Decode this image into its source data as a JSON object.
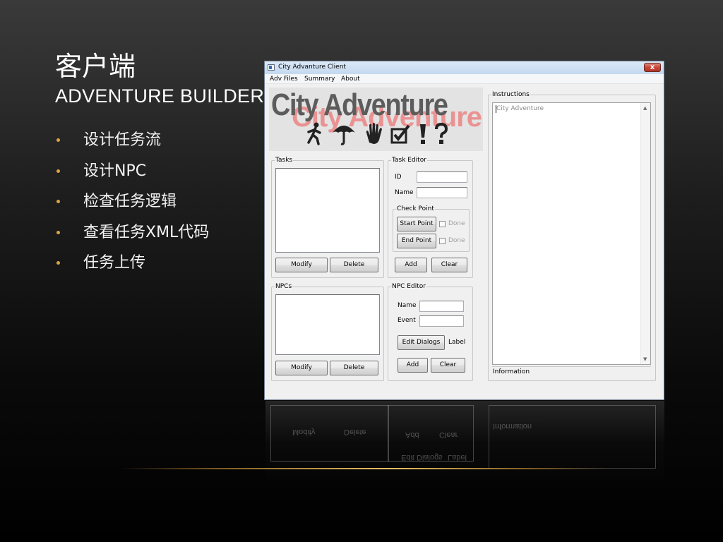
{
  "slide": {
    "title": "客户端",
    "subtitle": "ADVENTURE BUILDER",
    "bullets": [
      "设计任务流",
      "设计NPC",
      "检查任务逻辑",
      "查看任务XML代码",
      "任务上传"
    ],
    "bullet_color": "#d9a441",
    "accent_color": "#f0c060"
  },
  "window": {
    "title": "City Advanture Client",
    "close_glyph": "x",
    "menu": [
      "Adv Files",
      "Summary",
      "About"
    ]
  },
  "logo": {
    "text": "City Adventure",
    "icons": [
      "walking-person-icon",
      "umbrella-icon",
      "hand-icon",
      "checkbox-icon",
      "exclamation-icon",
      "question-icon"
    ]
  },
  "tasks": {
    "group_label": "Tasks",
    "modify_label": "Modify",
    "delete_label": "Delete"
  },
  "task_editor": {
    "group_label": "Task Editor",
    "id_label": "ID",
    "id_value": "",
    "name_label": "Name",
    "name_value": "",
    "check_point": {
      "group_label": "Check Point",
      "start_label": "Start Point",
      "end_label": "End Point",
      "done_label": "Done"
    },
    "add_label": "Add",
    "clear_label": "Clear"
  },
  "npcs": {
    "group_label": "NPCs",
    "modify_label": "Modify",
    "delete_label": "Delete"
  },
  "npc_editor": {
    "group_label": "NPC Editor",
    "name_label": "Name",
    "name_value": "",
    "event_label": "Event",
    "event_value": "",
    "edit_dialogs_label": "Edit Dialogs",
    "label_text": "Label",
    "add_label": "Add",
    "clear_label": "Clear"
  },
  "instructions": {
    "group_label": "Instructions",
    "content": "City Adventure"
  },
  "status": {
    "text": "Information"
  }
}
